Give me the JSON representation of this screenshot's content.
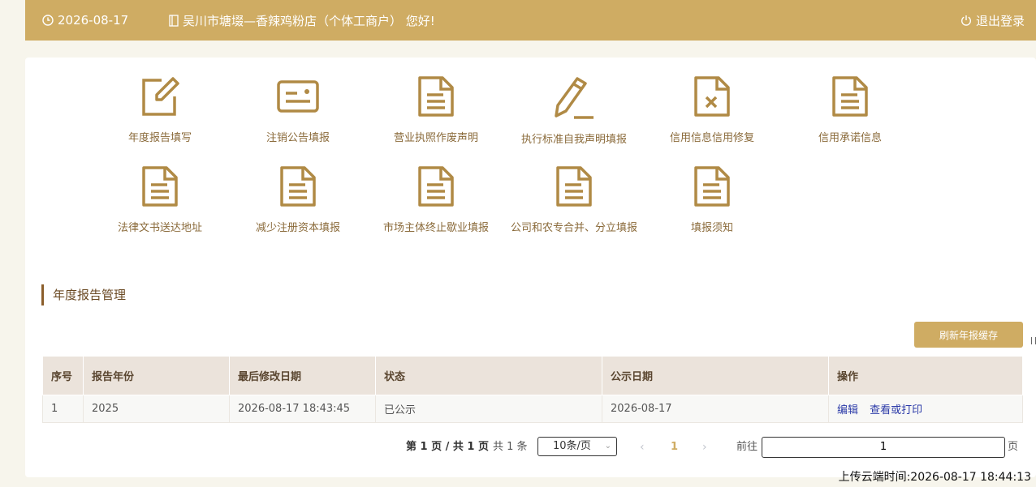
{
  "header": {
    "date": "2026-08-17",
    "greeting": "吴川市塘㙍—香辣鸡粉店（个体工商户） 您好!",
    "logout_label": "退出登录"
  },
  "menu": [
    {
      "label": "年度报告填写",
      "icon": "edit-icon"
    },
    {
      "label": "注销公告填报",
      "icon": "id-card-icon"
    },
    {
      "label": "营业执照作废声明",
      "icon": "document-icon"
    },
    {
      "label": "执行标准自我声明填报",
      "icon": "pencil-icon"
    },
    {
      "label": "信用信息信用修复",
      "icon": "document-x-icon"
    },
    {
      "label": "信用承诺信息",
      "icon": "document-icon"
    },
    {
      "label": "法律文书送达地址",
      "icon": "document-icon"
    },
    {
      "label": "减少注册资本填报",
      "icon": "document-icon"
    },
    {
      "label": "市场主体终止歇业填报",
      "icon": "document-icon"
    },
    {
      "label": "公司和农专合并、分立填报",
      "icon": "document-icon"
    },
    {
      "label": "填报须知",
      "icon": "document-icon"
    }
  ],
  "section": {
    "title": "年度报告管理",
    "refresh_label": "刷新年报缓存"
  },
  "table": {
    "headers": [
      "序号",
      "报告年份",
      "最后修改日期",
      "状态",
      "公示日期",
      "操作"
    ],
    "rows": [
      {
        "index": "1",
        "year": "2025",
        "modified": "2026-08-17 18:43:45",
        "status": "已公示",
        "publish_date": "2026-08-17",
        "actions": [
          "编辑",
          "查看或打印"
        ]
      }
    ]
  },
  "pagination": {
    "summary": "第 1 页 / 共 1 页",
    "total": "共 1 条",
    "page_size": "10条/页",
    "prev": "‹",
    "current_page": "1",
    "next": "›",
    "goto_label": "前往",
    "goto_value": "1",
    "page_unit": "页"
  },
  "footer": {
    "upload_time": "上传云端时间:2026-08-17 18:44:13"
  },
  "colors": {
    "accent": "#cfac63",
    "icon": "#b08a45",
    "label": "#8a6a3a",
    "section_bar": "#8b5e2b",
    "table_header": "#ebe3db",
    "link": "#2b3aa8"
  }
}
